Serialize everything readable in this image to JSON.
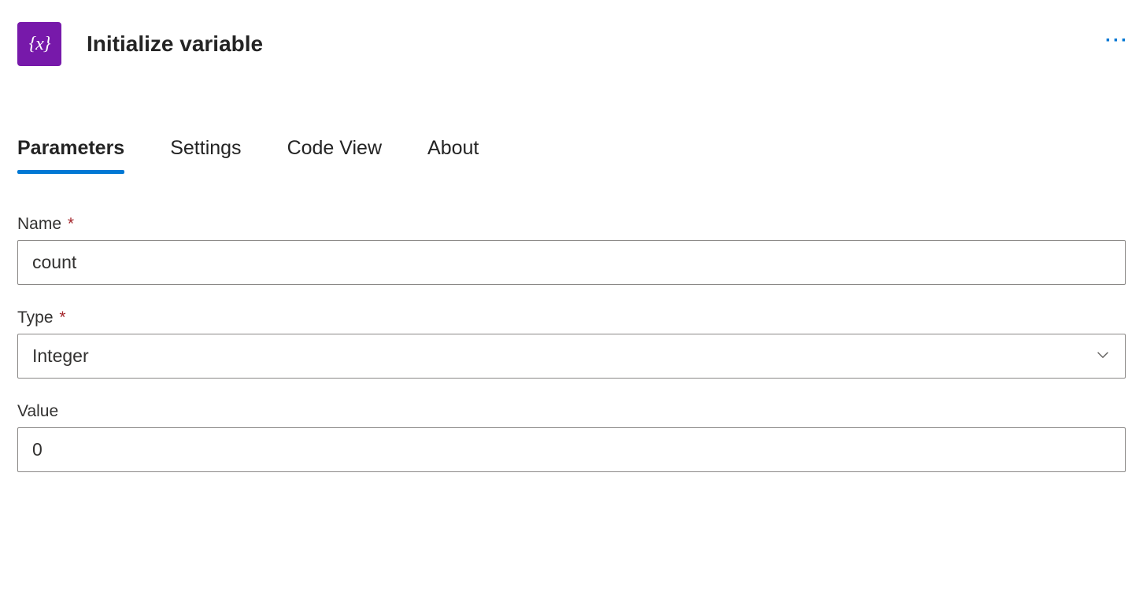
{
  "header": {
    "icon_text": "{x}",
    "title": "Initialize variable"
  },
  "tabs": [
    {
      "label": "Parameters",
      "active": true
    },
    {
      "label": "Settings",
      "active": false
    },
    {
      "label": "Code View",
      "active": false
    },
    {
      "label": "About",
      "active": false
    }
  ],
  "form": {
    "name": {
      "label": "Name",
      "required": true,
      "value": "count"
    },
    "type": {
      "label": "Type",
      "required": true,
      "value": "Integer"
    },
    "value": {
      "label": "Value",
      "required": false,
      "value": "0"
    }
  },
  "required_mark": "*"
}
